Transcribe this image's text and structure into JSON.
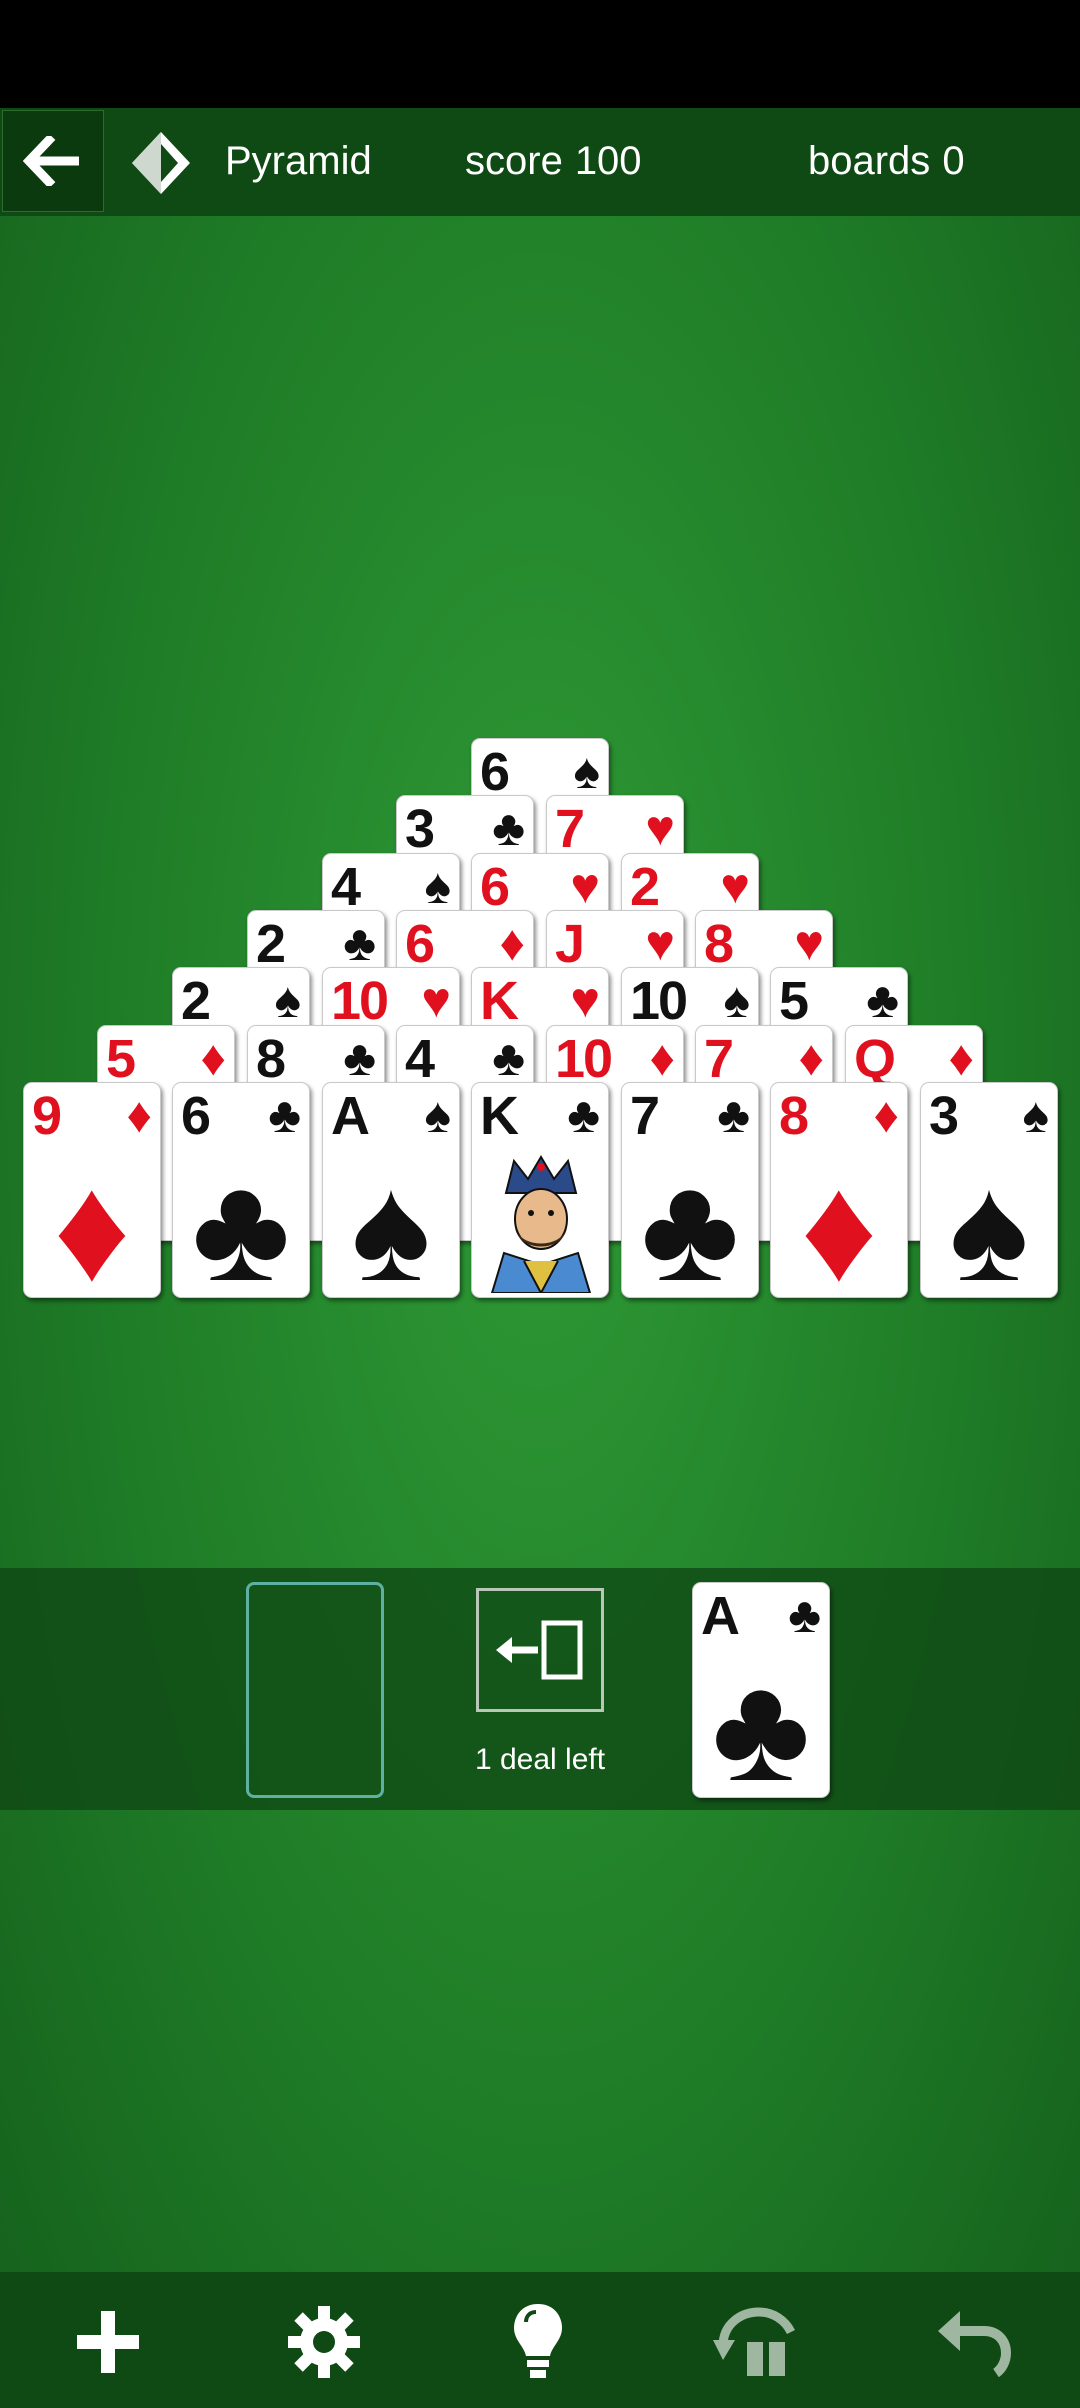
{
  "header": {
    "back_icon": "arrow-left-icon",
    "logo_icon": "pyramid-logo-icon",
    "title": "Pyramid",
    "score_label": "score",
    "score_value": "100",
    "boards_label": "boards",
    "boards_value": "0"
  },
  "pyramid": {
    "rows": [
      [
        {
          "rank": "6",
          "suit": "♠",
          "color": "black"
        }
      ],
      [
        {
          "rank": "3",
          "suit": "♣",
          "color": "black"
        },
        {
          "rank": "7",
          "suit": "♥",
          "color": "red"
        }
      ],
      [
        {
          "rank": "4",
          "suit": "♠",
          "color": "black"
        },
        {
          "rank": "6",
          "suit": "♥",
          "color": "red"
        },
        {
          "rank": "2",
          "suit": "♥",
          "color": "red"
        }
      ],
      [
        {
          "rank": "2",
          "suit": "♣",
          "color": "black"
        },
        {
          "rank": "6",
          "suit": "♦",
          "color": "red"
        },
        {
          "rank": "J",
          "suit": "♥",
          "color": "red"
        },
        {
          "rank": "8",
          "suit": "♥",
          "color": "red"
        }
      ],
      [
        {
          "rank": "2",
          "suit": "♠",
          "color": "black"
        },
        {
          "rank": "10",
          "suit": "♥",
          "color": "red"
        },
        {
          "rank": "K",
          "suit": "♥",
          "color": "red"
        },
        {
          "rank": "10",
          "suit": "♠",
          "color": "black"
        },
        {
          "rank": "5",
          "suit": "♣",
          "color": "black"
        }
      ],
      [
        {
          "rank": "5",
          "suit": "♦",
          "color": "red"
        },
        {
          "rank": "8",
          "suit": "♣",
          "color": "black"
        },
        {
          "rank": "4",
          "suit": "♣",
          "color": "black"
        },
        {
          "rank": "10",
          "suit": "♦",
          "color": "red"
        },
        {
          "rank": "7",
          "suit": "♦",
          "color": "red"
        },
        {
          "rank": "Q",
          "suit": "♦",
          "color": "red"
        }
      ],
      [
        {
          "rank": "9",
          "suit": "♦",
          "color": "red"
        },
        {
          "rank": "6",
          "suit": "♣",
          "color": "black"
        },
        {
          "rank": "A",
          "suit": "♠",
          "color": "black"
        },
        {
          "rank": "K",
          "suit": "♣",
          "color": "black",
          "face": true
        },
        {
          "rank": "7",
          "suit": "♣",
          "color": "black"
        },
        {
          "rank": "8",
          "suit": "♦",
          "color": "red"
        },
        {
          "rank": "3",
          "suit": "♠",
          "color": "black"
        }
      ]
    ]
  },
  "tray": {
    "deal_label": "1 deal left",
    "stock_icon": "redeal-arrow-icon",
    "waste": {
      "rank": "A",
      "suit": "♣",
      "color": "black"
    }
  },
  "toolbar": {
    "new_game_icon": "plus-icon",
    "settings_icon": "gear-icon",
    "hint_icon": "lightbulb-icon",
    "deal_icon": "deal-arrow-icon",
    "undo_icon": "undo-icon"
  },
  "colors": {
    "red_suit": "#e0101e",
    "black_suit": "#111111",
    "felt": "#1f7d27",
    "bar": "#0f4a14"
  }
}
